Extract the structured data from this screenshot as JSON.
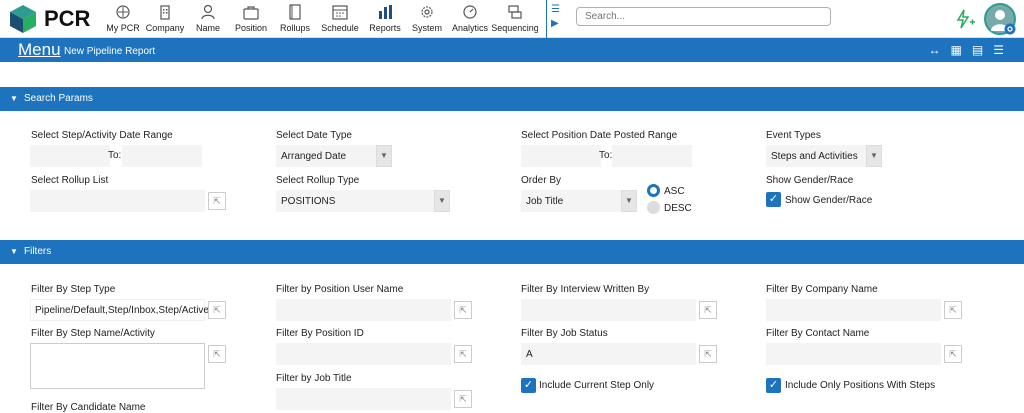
{
  "app": {
    "logo_text": "PCR"
  },
  "nav": [
    {
      "label": "My PCR",
      "icon": "grid-icon"
    },
    {
      "label": "Company",
      "icon": "building-icon"
    },
    {
      "label": "Name",
      "icon": "person-icon"
    },
    {
      "label": "Position",
      "icon": "briefcase-icon"
    },
    {
      "label": "Rollups",
      "icon": "rollups-icon"
    },
    {
      "label": "Schedule",
      "icon": "calendar-icon"
    },
    {
      "label": "Reports",
      "icon": "bar-chart-icon"
    },
    {
      "label": "System",
      "icon": "gear-icon"
    },
    {
      "label": "Analytics",
      "icon": "gauge-icon"
    },
    {
      "label": "Sequencing",
      "icon": "sequence-icon"
    }
  ],
  "search": {
    "placeholder": "Search..."
  },
  "menubar": {
    "title": "Menu",
    "subtitle": "New Pipeline Report"
  },
  "search_params": {
    "title": "Search Params",
    "step_date_range": {
      "label": "Select Step/Activity Date Range",
      "to": "To:"
    },
    "date_type": {
      "label": "Select Date Type",
      "value": "Arranged Date"
    },
    "position_date_range": {
      "label": "Select Position Date Posted Range",
      "to": "To:"
    },
    "event_types": {
      "label": "Event Types",
      "value": "Steps and Activities"
    },
    "rollup_list": {
      "label": "Select Rollup List",
      "value": ""
    },
    "rollup_type": {
      "label": "Select Rollup Type",
      "value": "POSITIONS"
    },
    "order_by": {
      "label": "Order By",
      "value": "Job Title",
      "asc": "ASC",
      "desc": "DESC"
    },
    "gender_race": {
      "label": "Show Gender/Race",
      "checkbox_label": "Show Gender/Race"
    }
  },
  "filters": {
    "title": "Filters",
    "step_type": {
      "label": "Filter By Step Type",
      "value": "Pipeline/Default,Step/Inbox,Step/Active"
    },
    "step_name": {
      "label": "Filter By Step Name/Activity",
      "value": ""
    },
    "candidate_name": {
      "label": "Filter By Candidate Name"
    },
    "position_user": {
      "label": "Filter by Position User Name",
      "value": ""
    },
    "position_id": {
      "label": "Filter By Position ID",
      "value": ""
    },
    "job_title": {
      "label": "Filter by Job Title",
      "value": ""
    },
    "interview_by": {
      "label": "Filter By Interview Written By",
      "value": ""
    },
    "job_status": {
      "label": "Filter By Job Status",
      "value": "A"
    },
    "current_step": {
      "label": "Include Current Step Only"
    },
    "company_name": {
      "label": "Filter By Company Name",
      "value": ""
    },
    "contact_name": {
      "label": "Filter By Contact Name",
      "value": ""
    },
    "only_positions": {
      "label": "Include Only Positions With Steps"
    }
  }
}
